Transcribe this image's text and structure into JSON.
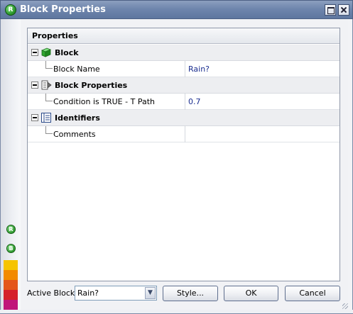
{
  "window": {
    "title": "Block Properties",
    "app_icon_glyph": "R"
  },
  "grid": {
    "header": "Properties",
    "categories": [
      {
        "label": "Block",
        "icon": "green-cube-icon",
        "properties": [
          {
            "name": "Block Name",
            "value": "Rain?"
          }
        ]
      },
      {
        "label": "Block Properties",
        "icon": "block-properties-icon",
        "properties": [
          {
            "name": "Condition is TRUE - T Path",
            "value": "0.7"
          }
        ]
      },
      {
        "label": "Identifiers",
        "icon": "identifiers-list-icon",
        "properties": [
          {
            "name": "Comments",
            "value": ""
          }
        ]
      }
    ]
  },
  "footer": {
    "active_block_label": "Active Block",
    "active_block_value": "Rain?",
    "style_button": "Style...",
    "ok_button": "OK",
    "cancel_button": "Cancel"
  },
  "rail": {
    "icon_top_glyph": "R",
    "icon_bottom_glyph": "B"
  },
  "colors": {
    "title_bar": "#6f86ad",
    "value_text": "#1a2d8f",
    "category_row": "#edeef1"
  }
}
